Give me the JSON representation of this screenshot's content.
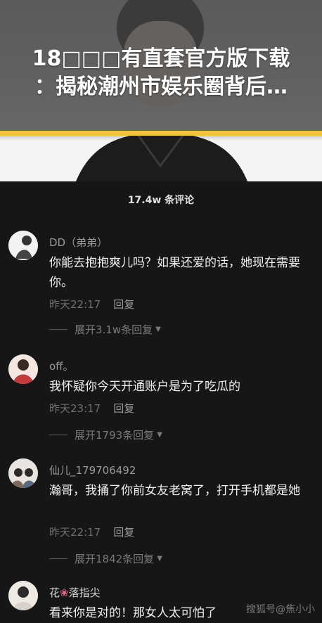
{
  "headline": {
    "line1": "18□□□有直套官方版下载",
    "line2": "：揭秘潮州市娱乐圈背后…"
  },
  "comments_count": "17.4w 条评论",
  "comments": [
    {
      "username": "DD（弟弟）",
      "text": "你能去抱抱爽儿吗？如果还爱的话，她现在需要你。",
      "time": "昨天22:17",
      "reply_label": "回复",
      "expand_label": "展开3.1w条回复"
    },
    {
      "username": "off。",
      "text": "我怀疑你今天开通账户是为了吃瓜的",
      "time": "昨天23:17",
      "reply_label": "回复",
      "expand_label": "展开1793条回复"
    },
    {
      "username": "仙儿_179706492",
      "text": "瀚哥，我捅了你前女友老窝了，打开手机都是她",
      "time": "昨天22:17",
      "reply_label": "回复",
      "expand_label": "展开1842条回复"
    },
    {
      "username_prefix": "花",
      "username_suffix": "落指尖",
      "text": "看来你是对的！那女人太可怕了"
    }
  ],
  "watermark": "搜狐号@焦小小",
  "colors": {
    "accent_bar": "#f4c531",
    "panel_bg": "#161616",
    "flower_icon": "#e26a8a"
  }
}
